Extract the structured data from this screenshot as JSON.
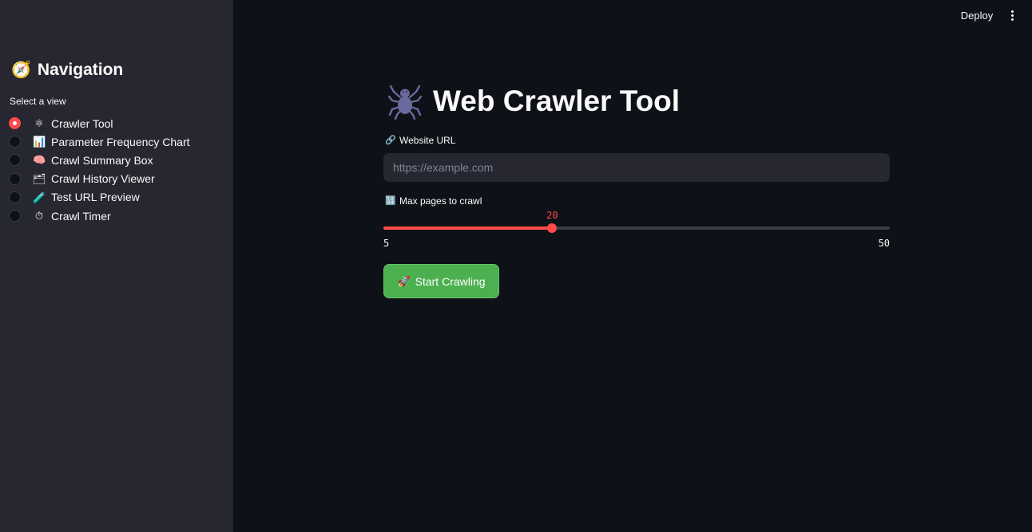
{
  "sidebar": {
    "title": "Navigation",
    "title_icon": "🧭",
    "select_label": "Select a view",
    "selected_index": 0,
    "items": [
      {
        "icon": "⚛",
        "label": "Crawler Tool",
        "checked": true
      },
      {
        "icon": "📊",
        "label": "Parameter Frequency Chart",
        "checked": false
      },
      {
        "icon": "🧠",
        "label": "Crawl Summary Box",
        "checked": false
      },
      {
        "icon": "🗂",
        "label": "Crawl History Viewer",
        "checked": false
      },
      {
        "icon": "🧪",
        "label": "Test URL Preview",
        "checked": false
      },
      {
        "icon": "⏱",
        "label": "Crawl Timer",
        "checked": false
      }
    ]
  },
  "header": {
    "deploy_label": "Deploy",
    "menu_icon": "vertical-ellipsis-icon"
  },
  "main": {
    "title": "Web Crawler Tool",
    "title_icon": "spider-icon",
    "url_field": {
      "label": "Website URL",
      "label_icon": "🔗",
      "value": "",
      "placeholder": "https://example.com"
    },
    "slider": {
      "label": "Max pages to crawl",
      "label_icon": "🔢",
      "value": 20,
      "min": 5,
      "max": 50,
      "accent": "#ff4b4b"
    },
    "start_button": {
      "label": "Start Crawling",
      "icon": "🚀",
      "color": "#4caf50"
    }
  },
  "colors": {
    "background": "#0e1117",
    "sidebar": "#262730",
    "accent": "#ff4b4b"
  }
}
